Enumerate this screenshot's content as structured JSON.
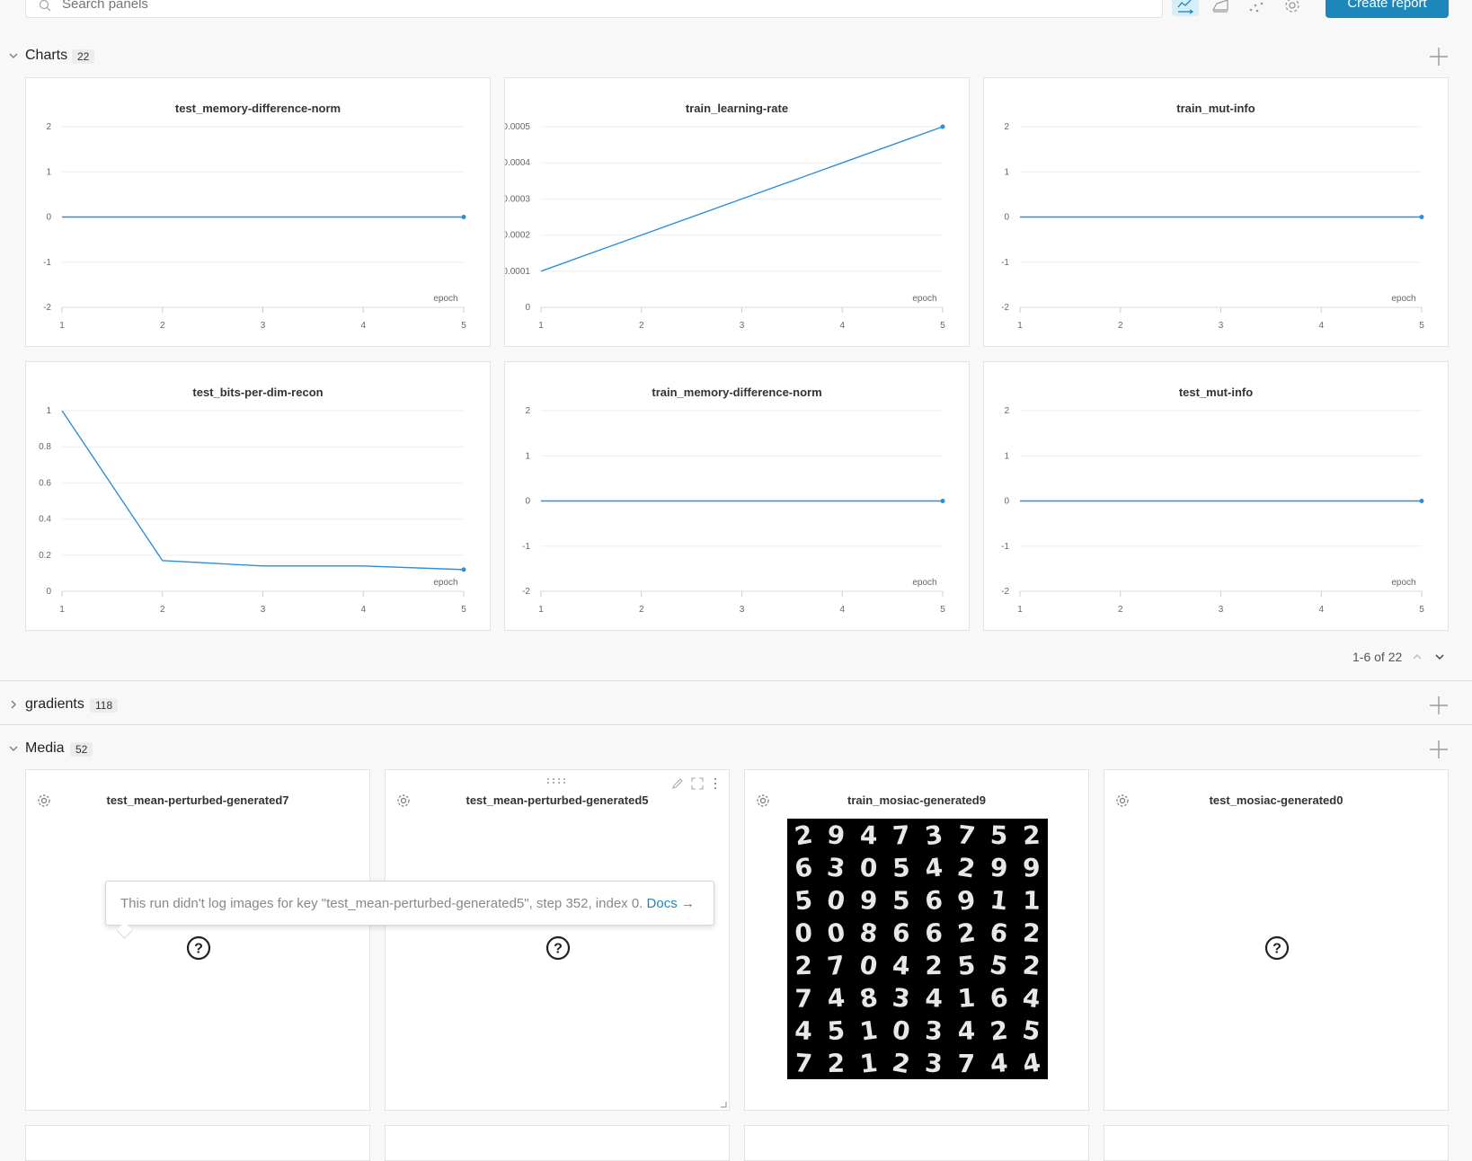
{
  "toolbar": {
    "search_placeholder": "Search panels",
    "create_report_label": "Create report",
    "tools": [
      "line-plot-icon",
      "area-plot-icon",
      "scatter-plot-icon",
      "gear-icon"
    ]
  },
  "sections": {
    "charts": {
      "title": "Charts",
      "count": "22"
    },
    "gradients": {
      "title": "gradients",
      "count": "118"
    },
    "media": {
      "title": "Media",
      "count": "52"
    }
  },
  "chart_data": [
    {
      "type": "line",
      "title": "test_memory-difference-norm",
      "xlabel": "epoch",
      "x": [
        1,
        2,
        3,
        4,
        5
      ],
      "y": [
        0,
        0,
        0,
        0,
        0
      ],
      "xticks": [
        "1",
        "2",
        "3",
        "4",
        "5"
      ],
      "yticks": [
        "2",
        "1",
        "0",
        "-1",
        "-2"
      ],
      "ylim": [
        -2,
        2
      ]
    },
    {
      "type": "line",
      "title": "train_learning-rate",
      "xlabel": "epoch",
      "x": [
        1,
        2,
        3,
        4,
        5
      ],
      "y": [
        0.0001,
        0.0002,
        0.0003,
        0.0004,
        0.0005
      ],
      "xticks": [
        "1",
        "2",
        "3",
        "4",
        "5"
      ],
      "yticks": [
        "0.0005",
        "0.0004",
        "0.0003",
        "0.0002",
        "0.0001",
        "0"
      ],
      "ylim": [
        0,
        0.0005
      ]
    },
    {
      "type": "line",
      "title": "train_mut-info",
      "xlabel": "epoch",
      "x": [
        1,
        2,
        3,
        4,
        5
      ],
      "y": [
        0,
        0,
        0,
        0,
        0
      ],
      "xticks": [
        "1",
        "2",
        "3",
        "4",
        "5"
      ],
      "yticks": [
        "2",
        "1",
        "0",
        "-1",
        "-2"
      ],
      "ylim": [
        -2,
        2
      ]
    },
    {
      "type": "line",
      "title": "test_bits-per-dim-recon",
      "xlabel": "epoch",
      "x": [
        1,
        2,
        3,
        4,
        5
      ],
      "y": [
        1,
        0.17,
        0.14,
        0.14,
        0.12
      ],
      "xticks": [
        "1",
        "2",
        "3",
        "4",
        "5"
      ],
      "yticks": [
        "1",
        "0.8",
        "0.6",
        "0.4",
        "0.2",
        "0"
      ],
      "ylim": [
        0,
        1
      ]
    },
    {
      "type": "line",
      "title": "train_memory-difference-norm",
      "xlabel": "epoch",
      "x": [
        1,
        2,
        3,
        4,
        5
      ],
      "y": [
        0,
        0,
        0,
        0,
        0
      ],
      "xticks": [
        "1",
        "2",
        "3",
        "4",
        "5"
      ],
      "yticks": [
        "2",
        "1",
        "0",
        "-1",
        "-2"
      ],
      "ylim": [
        -2,
        2
      ]
    },
    {
      "type": "line",
      "title": "test_mut-info",
      "xlabel": "epoch",
      "x": [
        1,
        2,
        3,
        4,
        5
      ],
      "y": [
        0,
        0,
        0,
        0,
        0
      ],
      "xticks": [
        "1",
        "2",
        "3",
        "4",
        "5"
      ],
      "yticks": [
        "2",
        "1",
        "0",
        "-1",
        "-2"
      ],
      "ylim": [
        -2,
        2
      ]
    }
  ],
  "pagination": {
    "label": "1-6 of 22"
  },
  "media_panels": [
    {
      "title": "test_mean-perturbed-generated7",
      "has_image": false
    },
    {
      "title": "test_mean-perturbed-generated5",
      "has_image": false
    },
    {
      "title": "train_mosiac-generated9",
      "has_image": true
    },
    {
      "title": "test_mosiac-generated0",
      "has_image": false
    }
  ],
  "tooltip": {
    "message": "This run didn't log images for key \"test_mean-perturbed-generated5\", step 352, index 0.",
    "link": "Docs →"
  },
  "mnist_digits": [
    "2",
    "9",
    "4",
    "7",
    "3",
    "7",
    "5",
    "2",
    "6",
    "3",
    "0",
    "5",
    "4",
    "2",
    "9",
    "9",
    "5",
    "0",
    "9",
    "5",
    "6",
    "9",
    "1",
    "1",
    "0",
    "0",
    "8",
    "6",
    "6",
    "2",
    "6",
    "2",
    "2",
    "7",
    "0",
    "4",
    "2",
    "5",
    "5",
    "2",
    "7",
    "4",
    "8",
    "3",
    "4",
    "1",
    "6",
    "4",
    "4",
    "5",
    "1",
    "0",
    "3",
    "4",
    "2",
    "5",
    "7",
    "2",
    "1",
    "2",
    "3",
    "7",
    "4",
    "4"
  ],
  "colors": {
    "accent": "#1d86ba",
    "line": "#2d8fd6"
  }
}
